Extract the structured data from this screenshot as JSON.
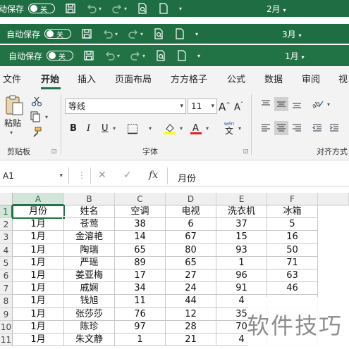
{
  "windows": [
    {
      "autosave_label": "自动保存",
      "toggle_label": "关",
      "month": "2月"
    },
    {
      "autosave_label": "自动保存",
      "toggle_label": "关",
      "month": "3月"
    },
    {
      "autosave_label": "自动保存",
      "toggle_label": "关",
      "month": "1月"
    }
  ],
  "ribbon_tabs": [
    "文件",
    "开始",
    "插入",
    "页面布局",
    "方方格子",
    "公式",
    "数据",
    "审阅",
    "视"
  ],
  "ribbon": {
    "paste_label": "粘贴",
    "clipboard_group": "剪贴板",
    "font_name": "等线",
    "font_size": "11",
    "bold": "B",
    "italic": "I",
    "underline": "U",
    "phonetic": "wén",
    "font_group": "字体",
    "align_group": "对齐方式"
  },
  "formula_bar": {
    "name_box": "A1",
    "cancel_symbol": "✕",
    "enter_symbol": "✓",
    "fx_label": "fx",
    "value": "月份"
  },
  "sheet": {
    "columns": [
      "A",
      "B",
      "C",
      "D",
      "E",
      "F"
    ],
    "row_numbers": [
      "1",
      "2",
      "3",
      "4",
      "5",
      "6",
      "7",
      "8",
      "9",
      "10",
      "11"
    ],
    "rows": [
      [
        "月份",
        "姓名",
        "空调",
        "电视",
        "洗衣机",
        "冰箱"
      ],
      [
        "1月",
        "苍莺",
        "38",
        "6",
        "37",
        "5"
      ],
      [
        "1月",
        "金溶艳",
        "14",
        "67",
        "15",
        "16"
      ],
      [
        "1月",
        "陶瑞",
        "65",
        "80",
        "93",
        "50"
      ],
      [
        "1月",
        "严瑶",
        "89",
        "65",
        "1",
        "71"
      ],
      [
        "1月",
        "姜亚梅",
        "17",
        "27",
        "96",
        "63"
      ],
      [
        "1月",
        "戚娴",
        "34",
        "24",
        "91",
        "46"
      ],
      [
        "1月",
        "钱旭",
        "11",
        "44",
        "4",
        ""
      ],
      [
        "1月",
        "张莎莎",
        "76",
        "12",
        "35",
        ""
      ],
      [
        "1月",
        "陈珍",
        "97",
        "28",
        "70",
        ""
      ],
      [
        "1月",
        "朱文静",
        "1",
        "21",
        "4",
        ""
      ]
    ]
  },
  "watermark": "软件技巧"
}
